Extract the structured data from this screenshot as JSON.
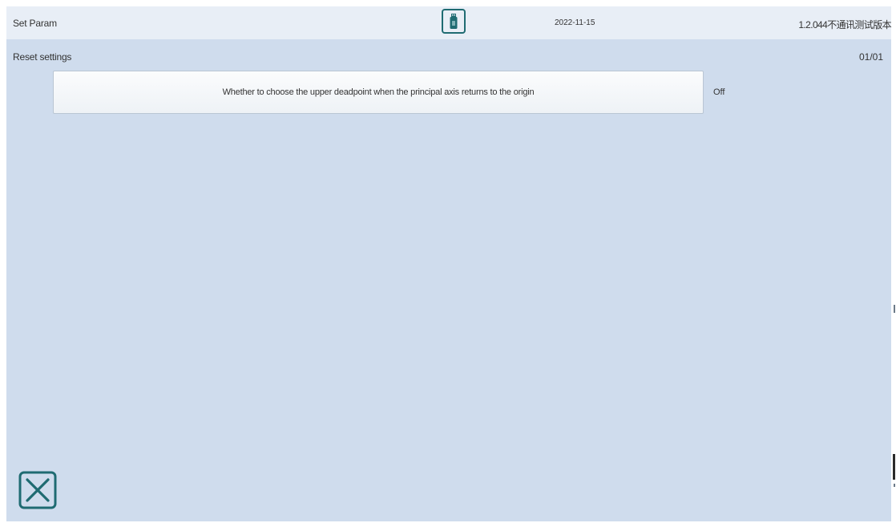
{
  "header": {
    "title": "Set Param",
    "usb_icon": "usb-drive-icon",
    "date": "2022-11-15",
    "version": "1.2.044不通讯测试版本"
  },
  "section": {
    "title": "Reset settings",
    "page": "01/01"
  },
  "params": [
    {
      "label": "Whether to choose the upper deadpoint when the principal axis returns to the origin",
      "value": "Off"
    }
  ],
  "footer": {
    "close_icon": "close-icon"
  },
  "colors": {
    "background": "#cfdced",
    "header": "#e8eef6",
    "accent": "#1f6b72",
    "button": "#f5f7fa"
  }
}
